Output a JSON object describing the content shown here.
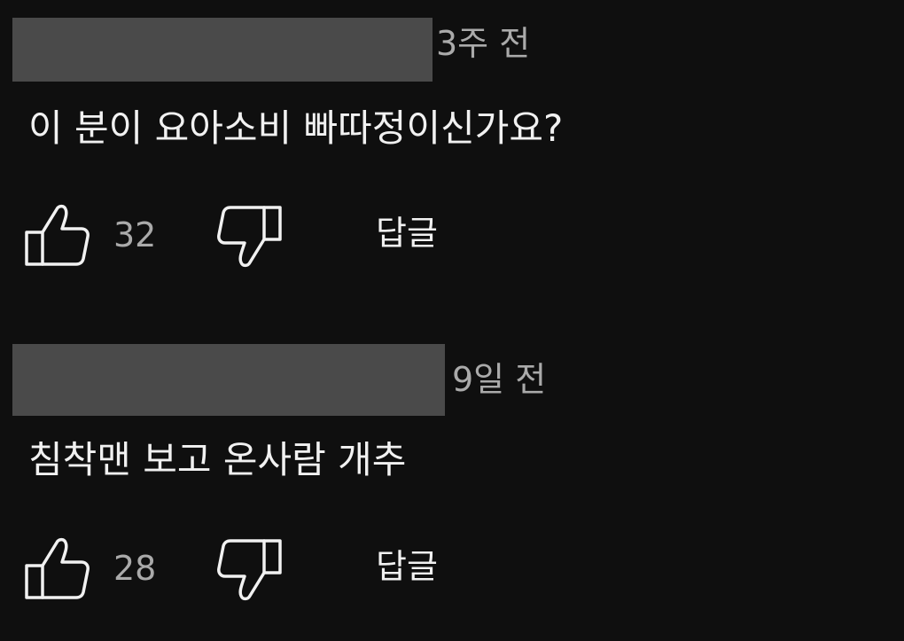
{
  "comments": [
    {
      "timestamp": "3주 전",
      "text": "이 분이 요아소비 빠따정이신가요?",
      "like_count": "32",
      "reply_label": "답글",
      "like_icon": "thumbs-up-icon",
      "dislike_icon": "thumbs-down-icon"
    },
    {
      "timestamp": "9일 전",
      "text": "침착맨 보고 온사람 개추",
      "like_count": "28",
      "reply_label": "답글",
      "like_icon": "thumbs-up-icon",
      "dislike_icon": "thumbs-down-icon"
    }
  ],
  "colors": {
    "background": "#0f0f0f",
    "primary_text": "#f1f1f1",
    "secondary_text": "#aaaaaa",
    "redaction": "#4a4a4a"
  }
}
